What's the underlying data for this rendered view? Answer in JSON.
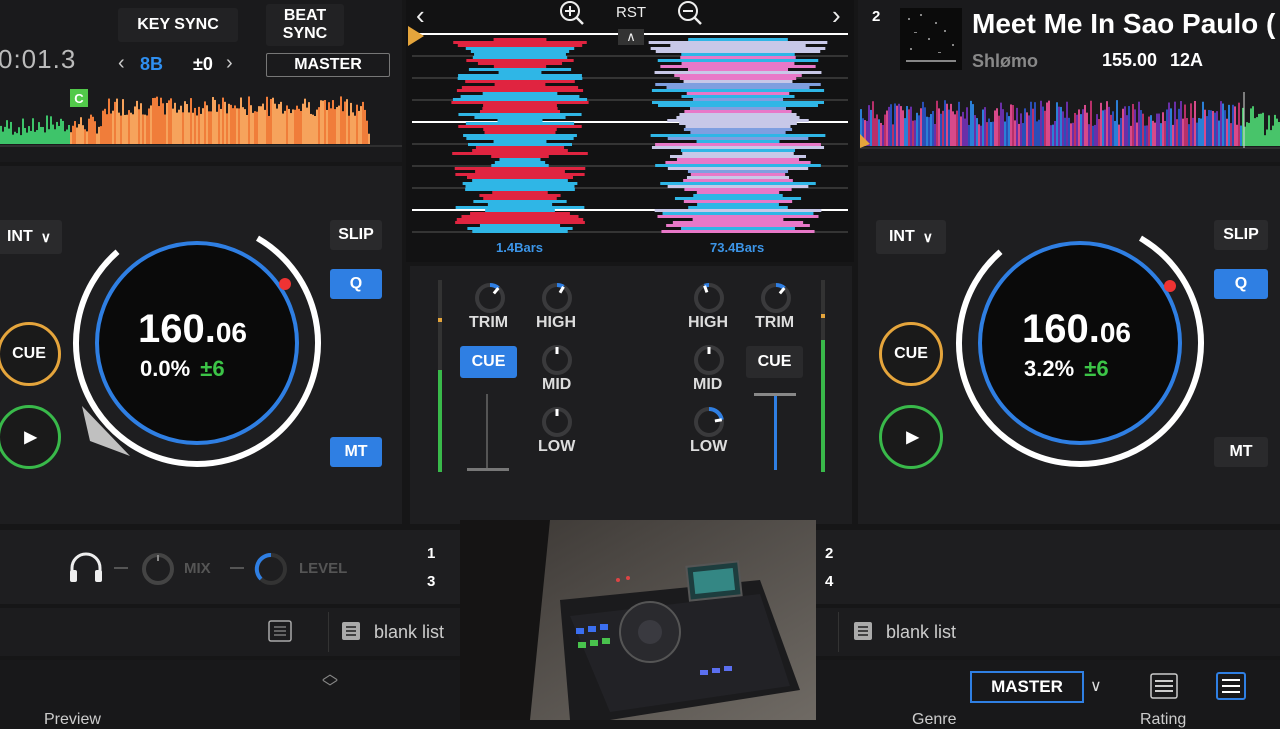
{
  "deck1": {
    "time": "0:01.3",
    "key_sync": "KEY SYNC",
    "beat_sync": "BEAT\nSYNC",
    "key": "8B",
    "key_offset": "±0",
    "master": "MASTER",
    "cue_marker": "C",
    "int": "INT",
    "slip": "SLIP",
    "q": "Q",
    "mt": "MT",
    "cue": "CUE",
    "bpm_main": "160.",
    "bpm_dec": "06",
    "pitch": "0.0%",
    "range": "±6"
  },
  "deck2": {
    "number": "2",
    "title": "Meet Me In Sao Paulo (",
    "artist": "Shlømo",
    "bpm": "155.00",
    "key": "12A",
    "int": "INT",
    "slip": "SLIP",
    "q": "Q",
    "mt": "MT",
    "cue": "CUE",
    "bpm_main": "160.",
    "bpm_dec": "06",
    "pitch": "3.2%",
    "range": "±6"
  },
  "waveform": {
    "rst": "RST",
    "left_bars": "1.4Bars",
    "right_bars": "73.4Bars"
  },
  "mixer": {
    "trim": "TRIM",
    "high": "HIGH",
    "mid": "MID",
    "low": "LOW",
    "cue": "CUE",
    "mix": "MIX",
    "level": "LEVEL",
    "deck_nums": [
      "1",
      "3",
      "2",
      "4"
    ],
    "levels": {
      "left_meter": 0.55,
      "right_meter": 0.75,
      "left_fader": 0.0,
      "right_fader": 1.0
    }
  },
  "browser": {
    "left_list": "blank list",
    "right_list": "blank list",
    "master": "MASTER",
    "col_preview": "Preview",
    "col_genre": "Genre",
    "col_rating": "Rating"
  },
  "colors": {
    "accent_blue": "#2f7fe3",
    "cue_orange": "#e5a53c",
    "play_green": "#39b94a",
    "key_green": "#3cc447"
  }
}
